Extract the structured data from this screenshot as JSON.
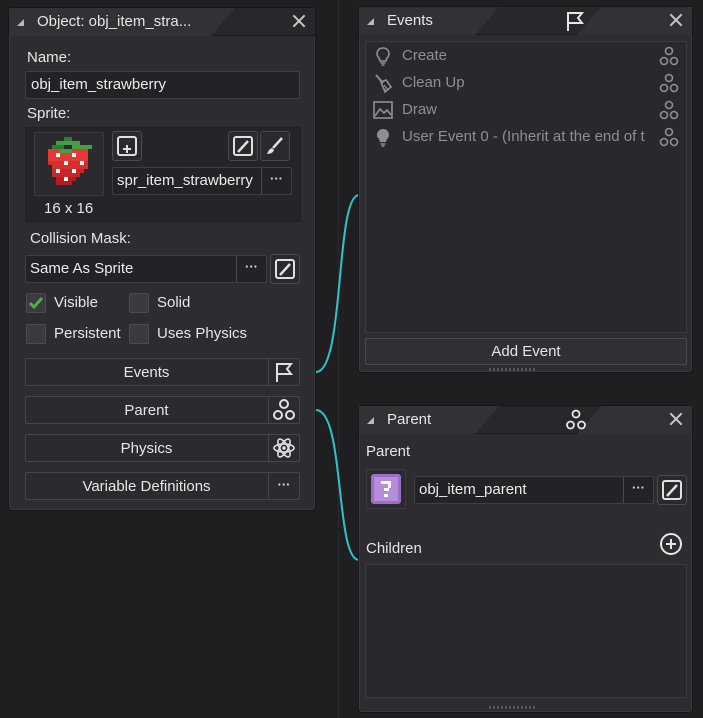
{
  "object_panel": {
    "title": "Object: obj_item_stra...",
    "name_label": "Name:",
    "name_value": "obj_item_strawberry",
    "sprite_label": "Sprite:",
    "sprite_size": "16 x 16",
    "sprite_name": "spr_item_strawberry",
    "dots": "···",
    "collision_label": "Collision Mask:",
    "collision_value": "Same As Sprite",
    "checkboxes": {
      "visible": "Visible",
      "solid": "Solid",
      "persistent": "Persistent",
      "uses_physics": "Uses Physics"
    },
    "buttons": {
      "events": "Events",
      "parent": "Parent",
      "physics": "Physics",
      "variable_definitions": "Variable Definitions"
    }
  },
  "events_panel": {
    "title": "Events",
    "events": [
      {
        "label": "Create",
        "icon": "lightbulb-outline-icon"
      },
      {
        "label": "Clean Up",
        "icon": "broom-icon"
      },
      {
        "label": "Draw",
        "icon": "picture-icon"
      },
      {
        "label": "User Event 0 - (Inherit at the end of t",
        "icon": "lightbulb-filled-icon"
      }
    ],
    "add_event": "Add Event"
  },
  "parent_panel": {
    "title": "Parent",
    "parent_label": "Parent",
    "parent_value": "obj_item_parent",
    "children_label": "Children"
  },
  "colors": {
    "connector": "#2ec4c9",
    "check_green": "#4caf50"
  }
}
